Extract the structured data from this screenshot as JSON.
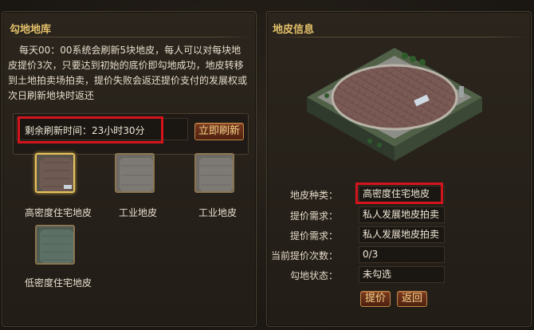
{
  "left_panel": {
    "title": "勾地地库",
    "description": "每天00：00系统会刷新5块地皮，每人可以对每块地皮提价3次，只要达到初始的底价即勾地成功，地皮转移到土地拍卖场拍卖，提价失败会返还提价支付的发展权或次日刷新地块时返还",
    "refresh_timer": "剩余刷新时间：23小时30分",
    "refresh_button": "立即刷新",
    "tiles": [
      {
        "label": "高密度住宅地皮",
        "selected": true,
        "kind": "high-density-residential-tile-icon"
      },
      {
        "label": "工业地皮",
        "selected": false,
        "kind": "industrial-tile-icon"
      },
      {
        "label": "工业地皮",
        "selected": false,
        "kind": "industrial-tile-icon"
      },
      {
        "label": "低密度住宅地皮",
        "selected": false,
        "kind": "low-density-residential-tile-icon"
      }
    ]
  },
  "right_panel": {
    "title": "地皮信息",
    "preview_icon": "land-plot-preview-icon",
    "rows": [
      {
        "label": "地皮种类：",
        "value": "高密度住宅地皮"
      },
      {
        "label": "提价需求：",
        "value": "私人发展地皮拍卖"
      },
      {
        "label": "提价需求：",
        "value": "私人发展地皮拍卖"
      },
      {
        "label": "当前提价次数：",
        "value": "0/3"
      },
      {
        "label": "勾地状态：",
        "value": "未勾选"
      }
    ],
    "bid_button": "提价",
    "back_button": "返回"
  },
  "colors": {
    "title": "#e3c06a",
    "highlight_box": "#d4141c",
    "panel_border": "#4a3f30",
    "button_text": "#f3d58a"
  }
}
